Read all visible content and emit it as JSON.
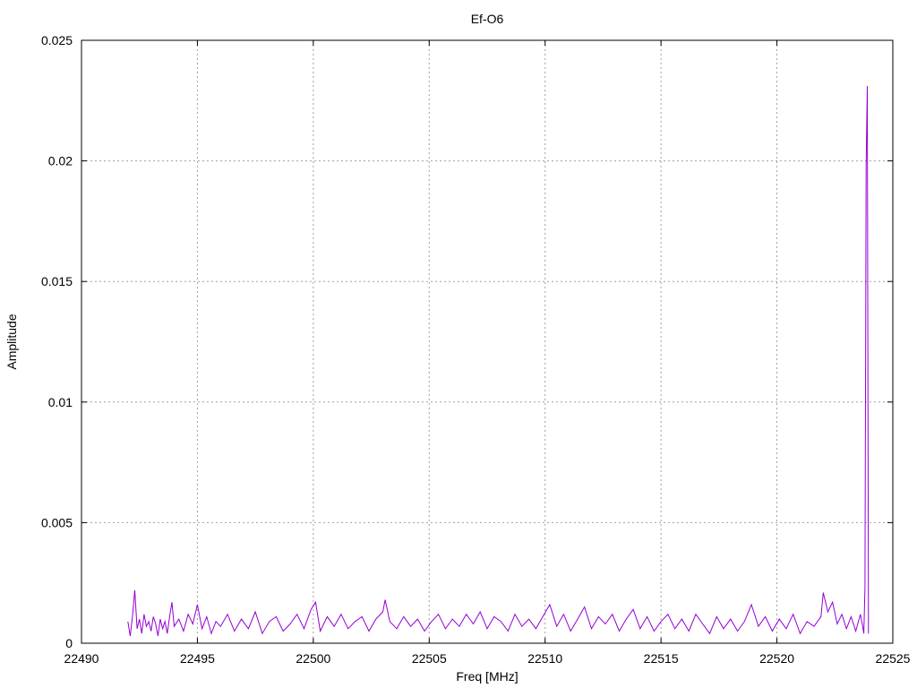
{
  "chart_data": {
    "type": "line",
    "title": "Ef-O6",
    "xlabel": "Freq [MHz]",
    "ylabel": "Amplitude",
    "xlim": [
      22490,
      22525
    ],
    "ylim": [
      0,
      0.025
    ],
    "x_ticks": [
      22490,
      22495,
      22500,
      22505,
      22510,
      22515,
      22520,
      22525
    ],
    "x_tick_labels": [
      "22490",
      "22495",
      "22500",
      "22505",
      "22510",
      "22515",
      "22520",
      "22525"
    ],
    "y_ticks": [
      0,
      0.005,
      0.01,
      0.015,
      0.02,
      0.025
    ],
    "y_tick_labels": [
      "0",
      "0.005",
      "0.01",
      "0.015",
      "0.02",
      "0.025"
    ],
    "grid": true,
    "series": [
      {
        "color": "#9400d3",
        "x": [
          22492.0,
          22492.1,
          22492.2,
          22492.3,
          22492.4,
          22492.5,
          22492.6,
          22492.7,
          22492.8,
          22492.9,
          22493.0,
          22493.1,
          22493.2,
          22493.3,
          22493.4,
          22493.5,
          22493.6,
          22493.7,
          22493.8,
          22493.9,
          22494.0,
          22494.2,
          22494.4,
          22494.6,
          22494.8,
          22495.0,
          22495.2,
          22495.4,
          22495.6,
          22495.8,
          22496.0,
          22496.3,
          22496.6,
          22496.9,
          22497.2,
          22497.5,
          22497.8,
          22498.1,
          22498.4,
          22498.7,
          22499.0,
          22499.3,
          22499.6,
          22499.9,
          22500.1,
          22500.3,
          22500.6,
          22500.9,
          22501.2,
          22501.5,
          22501.8,
          22502.1,
          22502.4,
          22502.7,
          22503.0,
          22503.1,
          22503.3,
          22503.6,
          22503.9,
          22504.2,
          22504.5,
          22504.8,
          22505.1,
          22505.4,
          22505.7,
          22506.0,
          22506.3,
          22506.6,
          22506.9,
          22507.2,
          22507.5,
          22507.8,
          22508.1,
          22508.4,
          22508.7,
          22509.0,
          22509.3,
          22509.6,
          22509.9,
          22510.2,
          22510.5,
          22510.8,
          22511.1,
          22511.4,
          22511.7,
          22512.0,
          22512.3,
          22512.6,
          22512.9,
          22513.2,
          22513.5,
          22513.8,
          22514.1,
          22514.4,
          22514.7,
          22515.0,
          22515.3,
          22515.6,
          22515.9,
          22516.2,
          22516.5,
          22516.8,
          22517.1,
          22517.4,
          22517.7,
          22518.0,
          22518.3,
          22518.6,
          22518.9,
          22519.2,
          22519.5,
          22519.8,
          22520.1,
          22520.4,
          22520.7,
          22521.0,
          22521.3,
          22521.6,
          22521.9,
          22522.0,
          22522.2,
          22522.4,
          22522.6,
          22522.8,
          22523.0,
          22523.2,
          22523.4,
          22523.6,
          22523.7,
          22523.75,
          22523.8,
          22523.85,
          22523.9,
          22523.95
        ],
        "y": [
          0.0009,
          0.0003,
          0.0011,
          0.0022,
          0.0006,
          0.001,
          0.0004,
          0.0012,
          0.0007,
          0.0009,
          0.0005,
          0.0011,
          0.0008,
          0.0003,
          0.001,
          0.0006,
          0.0009,
          0.0004,
          0.0011,
          0.0017,
          0.0007,
          0.001,
          0.0005,
          0.0012,
          0.0008,
          0.0016,
          0.0006,
          0.0011,
          0.0004,
          0.0009,
          0.0007,
          0.0012,
          0.0005,
          0.001,
          0.0006,
          0.0013,
          0.0004,
          0.0009,
          0.0011,
          0.0005,
          0.0008,
          0.0012,
          0.0006,
          0.0014,
          0.0017,
          0.0005,
          0.0011,
          0.0007,
          0.0012,
          0.0006,
          0.0009,
          0.0011,
          0.0005,
          0.001,
          0.0013,
          0.0018,
          0.0009,
          0.0006,
          0.0011,
          0.0007,
          0.001,
          0.0005,
          0.0009,
          0.0012,
          0.0006,
          0.001,
          0.0007,
          0.0012,
          0.0008,
          0.0013,
          0.0006,
          0.0011,
          0.0009,
          0.0005,
          0.0012,
          0.0007,
          0.001,
          0.0006,
          0.0011,
          0.0016,
          0.0007,
          0.0012,
          0.0005,
          0.001,
          0.0015,
          0.0006,
          0.0011,
          0.0008,
          0.0012,
          0.0005,
          0.001,
          0.0014,
          0.0006,
          0.0011,
          0.0005,
          0.0009,
          0.0012,
          0.0006,
          0.001,
          0.0005,
          0.0012,
          0.0008,
          0.0004,
          0.0011,
          0.0006,
          0.001,
          0.0005,
          0.0009,
          0.0016,
          0.0007,
          0.0011,
          0.0005,
          0.001,
          0.0006,
          0.0012,
          0.0004,
          0.0009,
          0.0007,
          0.0011,
          0.0021,
          0.0013,
          0.0017,
          0.0008,
          0.0012,
          0.0006,
          0.0011,
          0.0005,
          0.0012,
          0.0007,
          0.0004,
          0.0023,
          0.0198,
          0.0231,
          0.0004
        ]
      }
    ]
  }
}
